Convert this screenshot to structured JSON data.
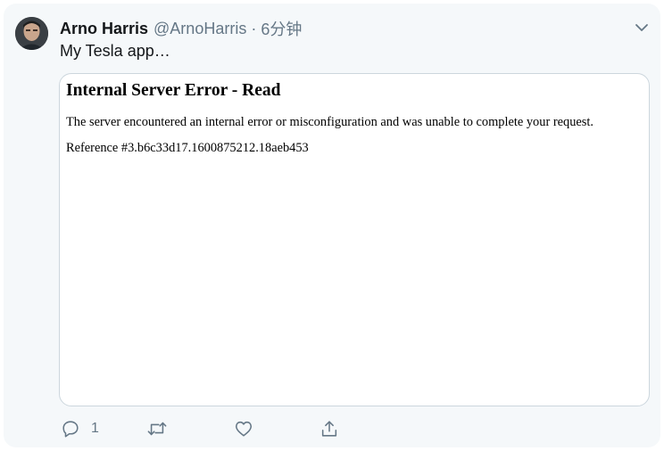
{
  "tweet": {
    "display_name": "Arno Harris",
    "handle": "@ArnoHarris",
    "separator": "·",
    "time": "6分钟",
    "text": "My Tesla app…"
  },
  "media": {
    "error_title": "Internal Server Error - Read",
    "error_message": "The server encountered an internal error or misconfiguration and was unable to complete your request.",
    "reference": "Reference #3.b6c33d17.1600875212.18aeb453"
  },
  "actions": {
    "reply_count": "1"
  },
  "colors": {
    "card_background": "#f5f8fa",
    "secondary_text": "#657786",
    "primary_text": "#14171a",
    "border": "#ccd6dd"
  },
  "icons": [
    "avatar",
    "chevron-down-icon",
    "reply-icon",
    "retweet-icon",
    "like-icon",
    "share-icon"
  ]
}
